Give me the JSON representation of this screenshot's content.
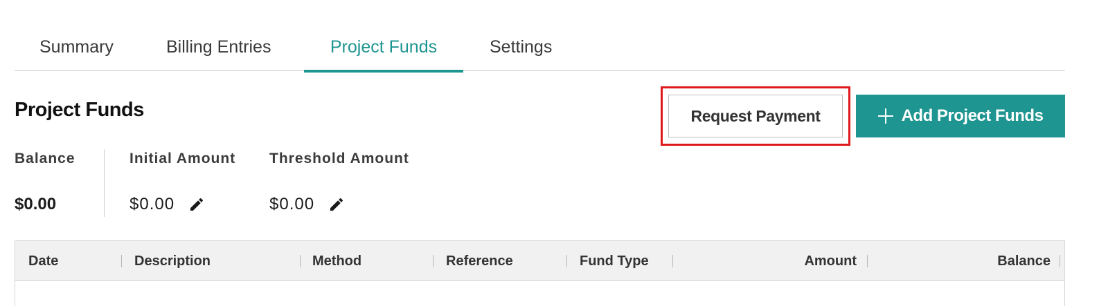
{
  "tabs": [
    {
      "label": "Summary",
      "active": false
    },
    {
      "label": "Billing Entries",
      "active": false
    },
    {
      "label": "Project Funds",
      "active": true
    },
    {
      "label": "Settings",
      "active": false
    }
  ],
  "page": {
    "title": "Project Funds"
  },
  "actions": {
    "request_payment_label": "Request Payment",
    "add_funds_label": "Add Project Funds",
    "add_funds_icon": "plus-icon"
  },
  "stats": {
    "balance": {
      "label": "Balance",
      "value": "$0.00"
    },
    "initial_amount": {
      "label": "Initial Amount",
      "value": "$0.00",
      "icon": "pencil-icon"
    },
    "threshold_amount": {
      "label": "Threshold Amount",
      "value": "$0.00",
      "icon": "pencil-icon"
    }
  },
  "table": {
    "columns": [
      "Date",
      "Description",
      "Method",
      "Reference",
      "Fund Type",
      "Amount",
      "Balance"
    ],
    "rows": []
  },
  "colors": {
    "accent": "#1e9590",
    "highlight": "#e0181b"
  }
}
